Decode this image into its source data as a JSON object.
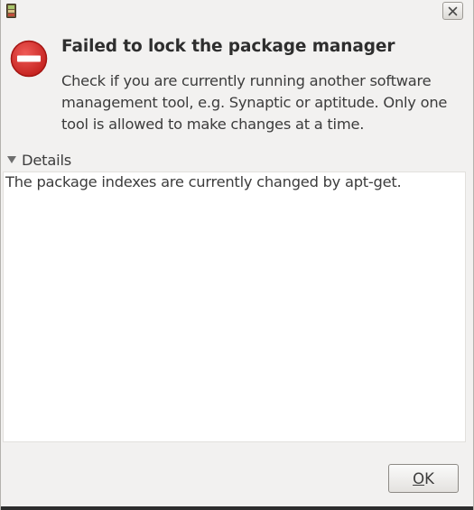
{
  "dialog": {
    "title": "Failed to lock the package manager",
    "message": "Check if you are currently running another software management tool, e.g. Synaptic or aptitude. Only one tool is allowed to make changes at a time.",
    "details_label": "Details",
    "details_text": "The package indexes are currently changed by apt-get.",
    "ok_label_accel": "O",
    "ok_label_rest": "K"
  },
  "icons": {
    "app": "package-manager-icon",
    "close": "close-icon",
    "error": "error-icon",
    "expander": "triangle-down-icon"
  },
  "colors": {
    "window_bg": "#f2f1f0",
    "error_red": "#d3322f",
    "text": "#3c3c3c"
  }
}
